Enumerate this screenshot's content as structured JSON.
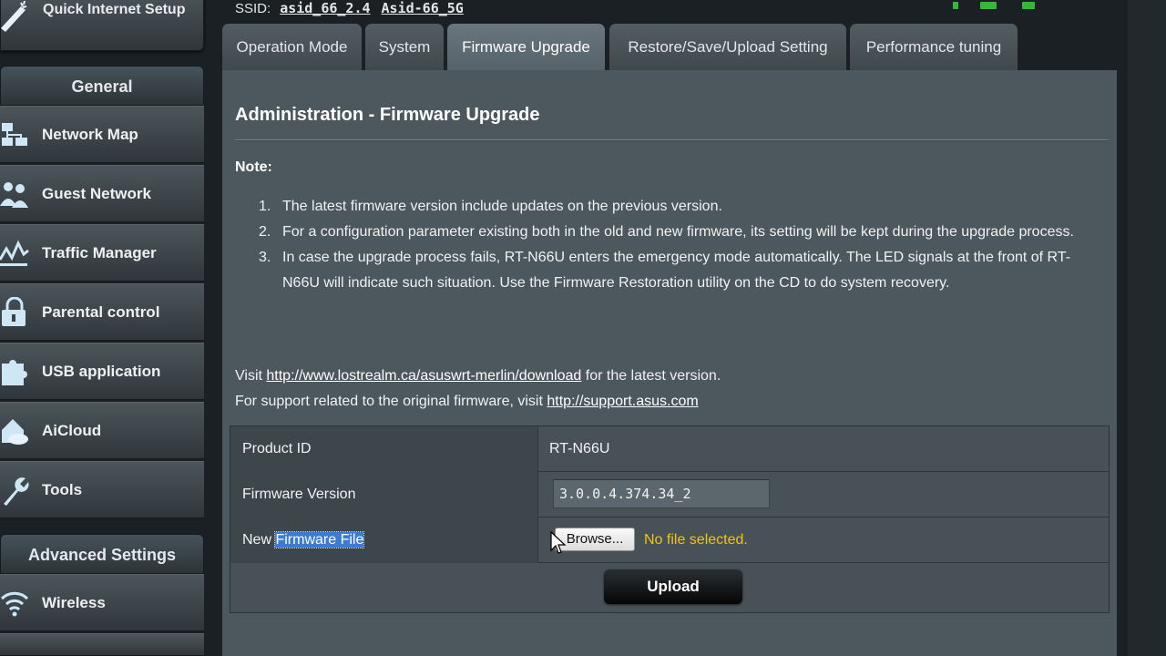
{
  "sidebar": {
    "quick_setup_label": "Quick Internet Setup",
    "general_header": "General",
    "items": [
      {
        "label": "Network Map",
        "icon": "network-map-icon"
      },
      {
        "label": "Guest Network",
        "icon": "guest-network-icon"
      },
      {
        "label": "Traffic Manager",
        "icon": "traffic-manager-icon"
      },
      {
        "label": "Parental control",
        "icon": "lock-icon"
      },
      {
        "label": "USB application",
        "icon": "puzzle-icon"
      },
      {
        "label": "AiCloud",
        "icon": "cloud-home-icon"
      },
      {
        "label": "Tools",
        "icon": "wrench-icon"
      }
    ],
    "advanced_header": "Advanced Settings",
    "advanced_items": [
      {
        "label": "Wireless",
        "icon": "wifi-icon"
      }
    ]
  },
  "topbar": {
    "ssid_label": "SSID:",
    "ssid_24": "asid_66_2.4",
    "ssid_5": "Asid-66_5G"
  },
  "tabs": [
    {
      "label": "Operation Mode",
      "active": false
    },
    {
      "label": "System",
      "active": false
    },
    {
      "label": "Firmware Upgrade",
      "active": true
    },
    {
      "label": "Restore/Save/Upload Setting",
      "active": false
    },
    {
      "label": "Performance tuning",
      "active": false
    }
  ],
  "main": {
    "title": "Administration - Firmware Upgrade",
    "note_label": "Note:",
    "notes": [
      {
        "num": "1.",
        "text": "The latest firmware version include updates on the previous version."
      },
      {
        "num": "2.",
        "text": "For a configuration parameter existing both in the old and new firmware, its setting will be kept during the upgrade process."
      },
      {
        "num": "3.",
        "text": "In case the upgrade process fails, RT-N66U enters the emergency mode automatically. The LED signals at the front of RT-N66U will indicate such situation. Use the Firmware Restoration utility on the CD to do system recovery."
      }
    ],
    "visit_prefix": "Visit",
    "visit_link": "http://www.lostrealm.ca/asuswrt-merlin/download",
    "visit_suffix": "for the latest version.",
    "support_prefix": "For support related to the original firmware, visit",
    "support_link": "http://support.asus.com"
  },
  "form": {
    "product_id_label": "Product ID",
    "product_id_value": "RT-N66U",
    "firmware_version_label": "Firmware Version",
    "firmware_version_value": "3.0.0.4.374.34_2",
    "new_label_prefix": "New",
    "new_label_highlight": "Firmware File",
    "browse_label": "Browse...",
    "no_file_text": "No file selected.",
    "upload_label": "Upload"
  },
  "colors": {
    "panel": "#4d585e",
    "accent_yellow": "#f3c312",
    "selection_blue": "#3d7bd0"
  }
}
